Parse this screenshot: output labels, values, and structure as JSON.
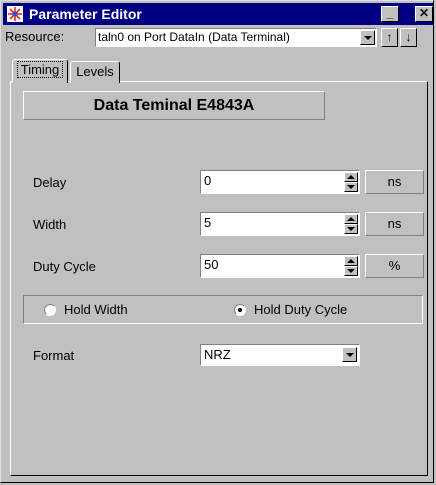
{
  "window": {
    "title": "Parameter Editor",
    "icon": "parameter-editor-icon",
    "minimize_label": "_",
    "close_label": "✕"
  },
  "resource": {
    "label": "Resource:",
    "value": "taln0 on Port DataIn (Data Terminal)",
    "up_label": "↑",
    "down_label": "↓"
  },
  "tabs": [
    {
      "label": "Timing",
      "active": true
    },
    {
      "label": "Levels",
      "active": false
    }
  ],
  "header": "Data Teminal E4843A",
  "fields": {
    "delay": {
      "label": "Delay",
      "value": "0",
      "unit": "ns"
    },
    "width": {
      "label": "Width",
      "value": "5",
      "unit": "ns"
    },
    "duty_cycle": {
      "label": "Duty Cycle",
      "value": "50",
      "unit": "%"
    }
  },
  "hold": {
    "options": [
      {
        "label": "Hold Width",
        "selected": false
      },
      {
        "label": "Hold Duty Cycle",
        "selected": true
      }
    ]
  },
  "format": {
    "label": "Format",
    "value": "NRZ"
  },
  "colors": {
    "titlebar": "#000080",
    "face": "#c0c0c0"
  }
}
